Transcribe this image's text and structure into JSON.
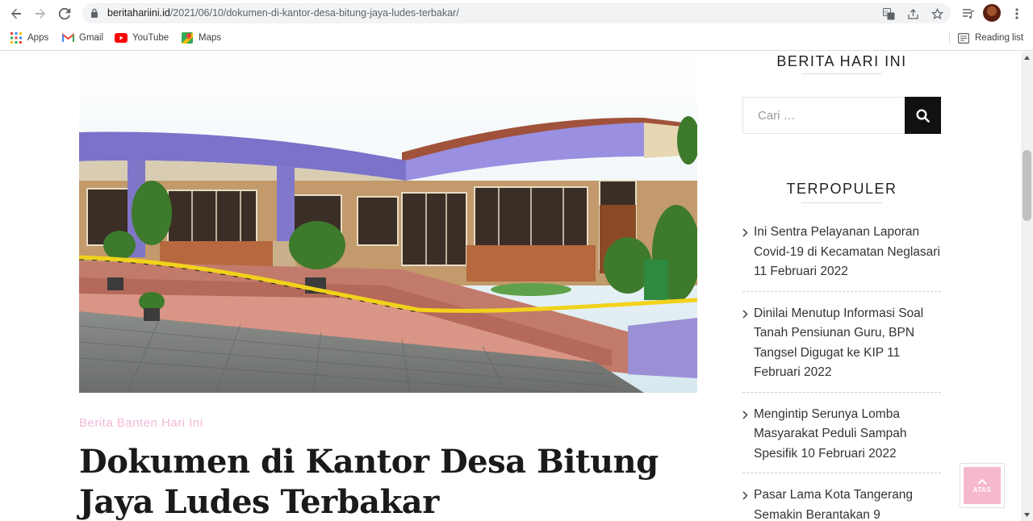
{
  "browser": {
    "url_host": "beritahariini.id",
    "url_path": "/2021/06/10/dokumen-di-kantor-desa-bitung-jaya-ludes-terbakar/",
    "bookmarks": [
      {
        "label": "Apps",
        "icon": "apps-grid-icon"
      },
      {
        "label": "Gmail",
        "icon": "gmail-icon"
      },
      {
        "label": "YouTube",
        "icon": "youtube-icon"
      },
      {
        "label": "Maps",
        "icon": "maps-icon"
      }
    ],
    "reading_list": "Reading list"
  },
  "article": {
    "category": "Berita Banten Hari Ini",
    "title": "Dokumen di Kantor Desa Bitung Jaya Ludes Terbakar"
  },
  "sidebar": {
    "site_title": "BERITA HARI INI",
    "search_placeholder": "Cari …",
    "popular_title": "TERPOPULER",
    "popular": [
      "Ini Sentra Pelayanan Laporan Covid-19 di Kecamatan Neglasari 11 Februari 2022",
      "Dinilai Menutup Informasi Soal Tanah Pensiunan Guru, BPN Tangsel Digugat ke KIP 11 Februari 2022",
      "Mengintip Serunya Lomba Masyarakat Peduli Sampah Spesifik 10 Februari 2022",
      "Pasar Lama Kota Tangerang Semakin Berantakan 9"
    ]
  },
  "back_to_top": {
    "label": "ATAS"
  },
  "colors": {
    "category": "#f2b8d8",
    "accent": "#f5b8cf"
  }
}
